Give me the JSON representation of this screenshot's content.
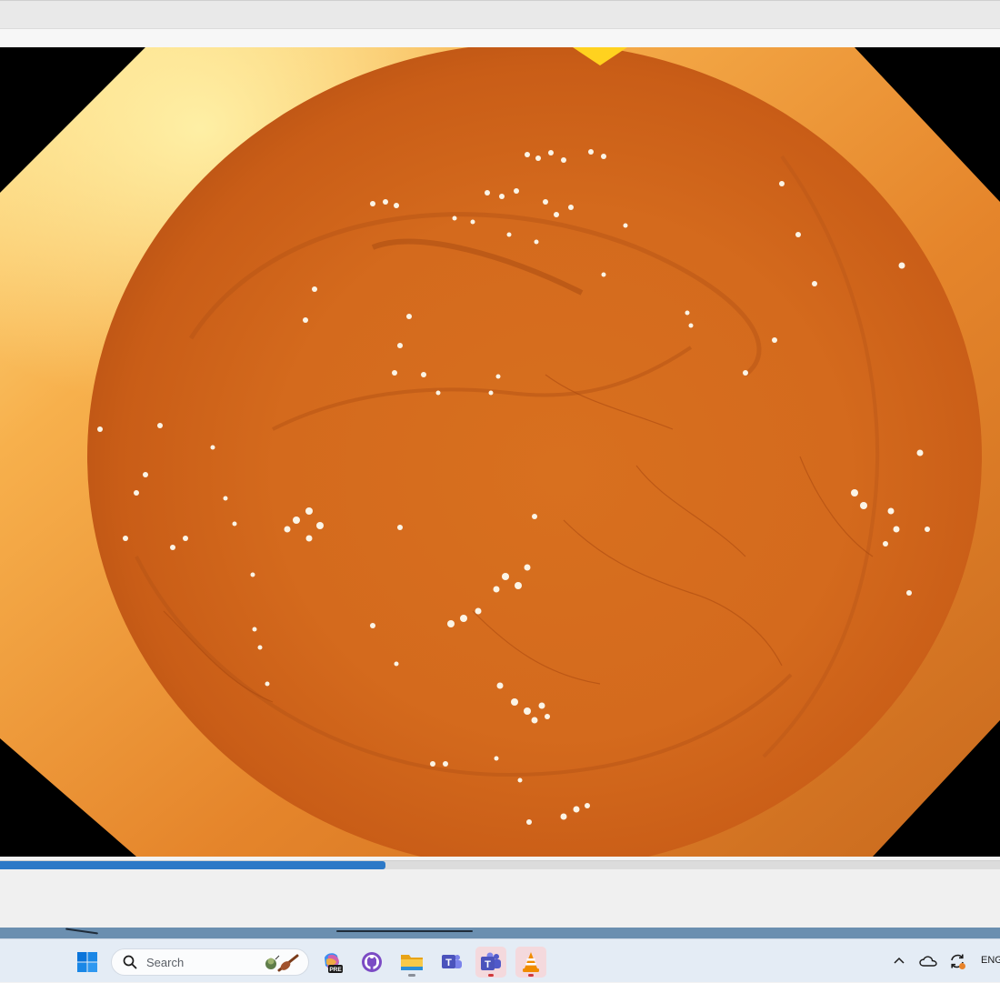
{
  "window": {
    "title": ""
  },
  "player": {
    "progress": 0.385,
    "colors": {
      "progress_fill": "#2d79c7",
      "progress_track": "#dcdcdc"
    }
  },
  "taskbar": {
    "search": {
      "placeholder": "Search"
    },
    "apps": [
      {
        "name": "start-icon"
      },
      {
        "name": "search-icon"
      },
      {
        "name": "copilot-icon",
        "badge": "PRE"
      },
      {
        "name": "github-icon"
      },
      {
        "name": "file-explorer-icon"
      },
      {
        "name": "teams-classic-icon"
      },
      {
        "name": "teams-icon"
      },
      {
        "name": "vlc-icon"
      }
    ],
    "tray": {
      "chevron": "chevron-up-icon",
      "onedrive": "cloud-icon",
      "sync": "sync-icon",
      "language": "ENG"
    },
    "colors": {
      "bar": "#e4ecf5",
      "active": "#f4d9dd",
      "accent": "#0078d4"
    }
  }
}
